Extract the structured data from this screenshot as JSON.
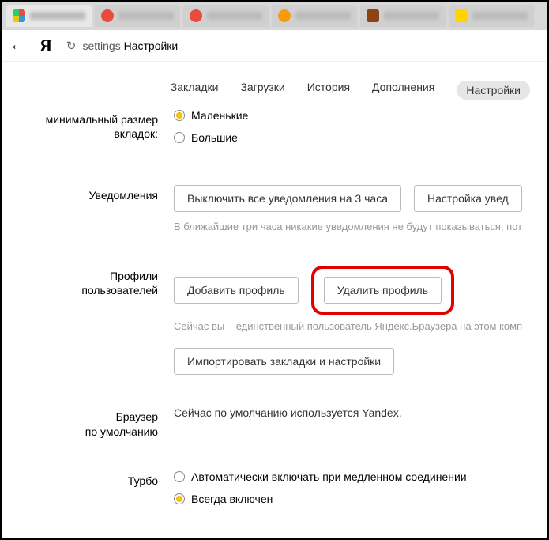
{
  "url": {
    "prefix": "settings",
    "suffix": "Настройки"
  },
  "subnav": {
    "bookmarks": "Закладки",
    "downloads": "Загрузки",
    "history": "История",
    "addons": "Дополнения",
    "settings": "Настройки"
  },
  "tabs_size": {
    "label_line1": "минимальный размер",
    "label_line2": "вкладок:",
    "small": "Маленькие",
    "large": "Большие"
  },
  "notifications": {
    "label": "Уведомления",
    "disable_btn": "Выключить все уведомления на 3 часа",
    "configure_btn": "Настройка увед",
    "hint": "В ближайшие три часа никакие уведомления не будут показываться, пот"
  },
  "profiles": {
    "label_line1": "Профили",
    "label_line2": "пользователей",
    "add_btn": "Добавить профиль",
    "delete_btn": "Удалить профиль",
    "hint": "Сейчас вы – единственный пользователь Яндекс.Браузера на этом комп",
    "import_btn": "Импортировать закладки и настройки"
  },
  "default_browser": {
    "label_line1": "Браузер",
    "label_line2": "по умолчанию",
    "text": "Сейчас по умолчанию используется Yandex."
  },
  "turbo": {
    "label": "Турбо",
    "auto": "Автоматически включать при медленном соединении",
    "always": "Всегда включен"
  }
}
